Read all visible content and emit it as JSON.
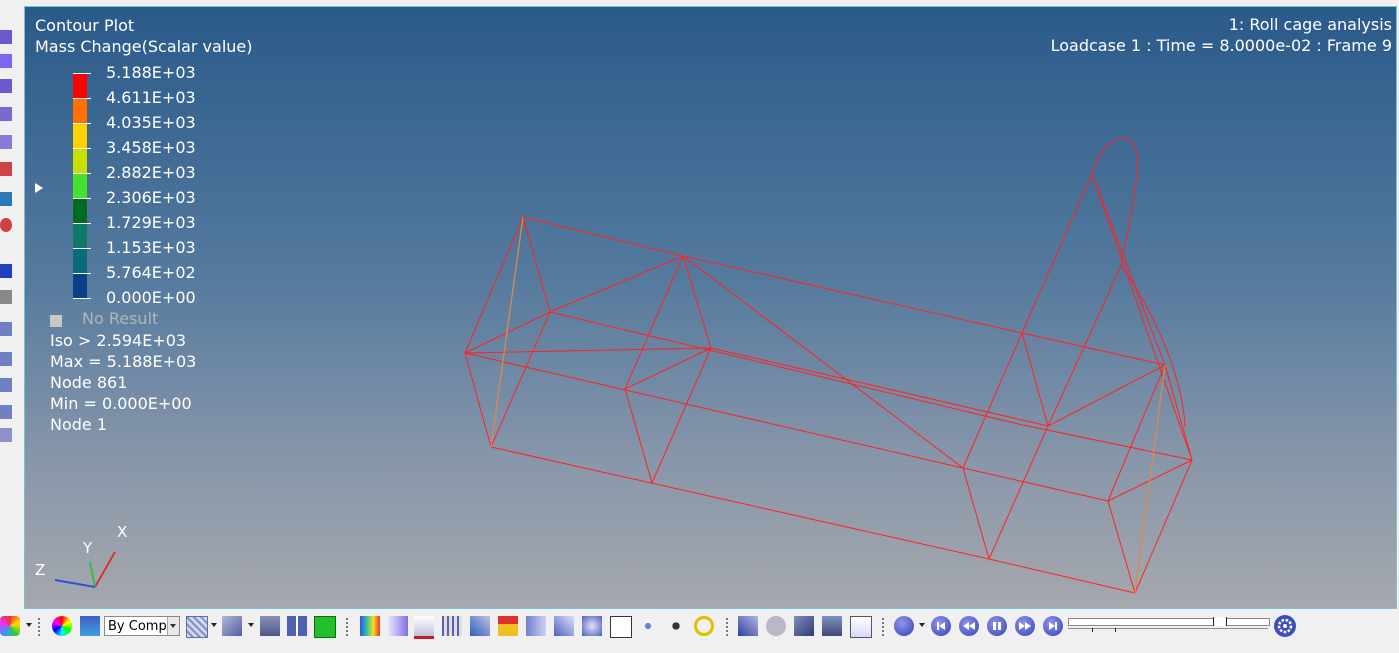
{
  "header": {
    "plot_type": "Contour Plot",
    "result_type": "Mass Change(Scalar value)",
    "model_title": "1: Roll cage analysis",
    "loadcase": "Loadcase 1 : Time = 8.0000e-02 : Frame 9"
  },
  "legend": {
    "values": [
      "5.188E+03",
      "4.611E+03",
      "4.035E+03",
      "3.458E+03",
      "2.882E+03",
      "2.306E+03",
      "1.729E+03",
      "1.153E+03",
      "5.764E+02",
      "0.000E+00"
    ],
    "colors": [
      "#ff0000",
      "#ff7000",
      "#ffd000",
      "#c8e000",
      "#48e030",
      "#006a20",
      "#127868",
      "#0a6a78",
      "#08408a",
      "#050a60"
    ],
    "no_result_label": "No Result"
  },
  "stats": {
    "iso": "Iso > 2.594E+03",
    "max": "Max =  5.188E+03",
    "max_node": "Node 861",
    "min": "Min =  0.000E+00",
    "min_node": "Node 1"
  },
  "triad": {
    "x": "X",
    "y": "Y",
    "z": "Z"
  },
  "toolbar": {
    "display_mode": "By Comp"
  }
}
